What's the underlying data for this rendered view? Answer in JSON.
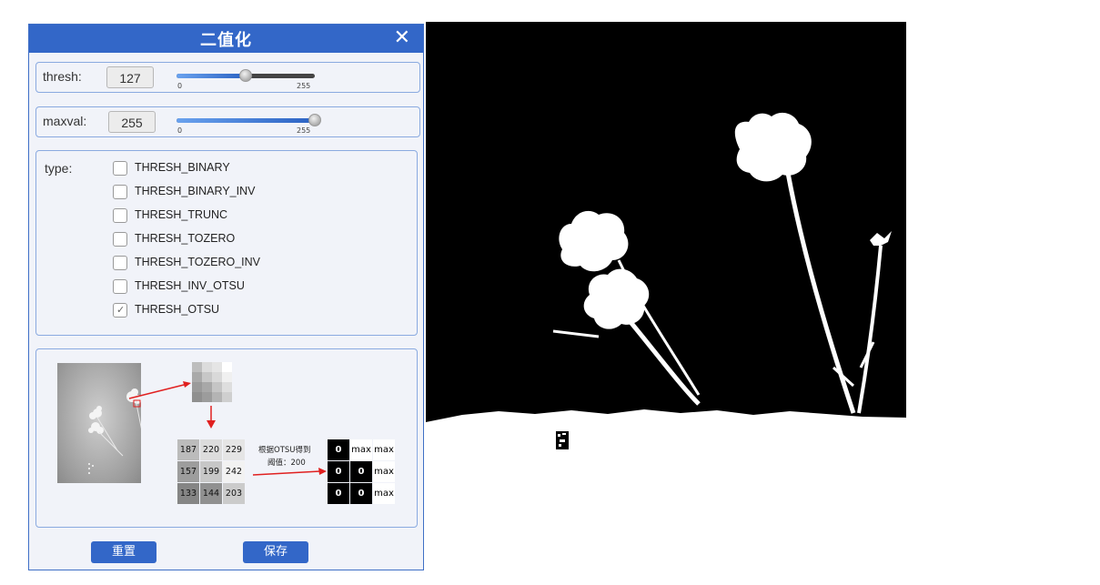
{
  "dialog": {
    "title": "二值化",
    "close_glyph": "✕",
    "thresh": {
      "label": "thresh:",
      "value": "127",
      "min_label": "0",
      "max_label": "255",
      "fraction": 0.498
    },
    "maxval": {
      "label": "maxval:",
      "value": "255",
      "min_label": "0",
      "max_label": "255",
      "fraction": 1.0
    },
    "type": {
      "label": "type:",
      "options": [
        {
          "label": "THRESH_BINARY",
          "checked": false
        },
        {
          "label": "THRESH_BINARY_INV",
          "checked": false
        },
        {
          "label": "THRESH_TRUNC",
          "checked": false
        },
        {
          "label": "THRESH_TOZERO",
          "checked": false
        },
        {
          "label": "THRESH_TOZERO_INV",
          "checked": false
        },
        {
          "label": "THRESH_INV_OTSU",
          "checked": false
        },
        {
          "label": "THRESH_OTSU",
          "checked": true
        }
      ]
    },
    "illustration": {
      "gray_values": [
        [
          "187",
          "220",
          "229"
        ],
        [
          "157",
          "199",
          "242"
        ],
        [
          "133",
          "144",
          "203"
        ]
      ],
      "note_line1": "根据OTSU得到",
      "note_line2": "阈值：200",
      "binary_values": [
        [
          "0",
          "max",
          "max"
        ],
        [
          "0",
          "0",
          "max"
        ],
        [
          "0",
          "0",
          "max"
        ]
      ]
    },
    "buttons": {
      "reset": "重置",
      "save": "保存"
    }
  },
  "colors": {
    "accent": "#3367c8",
    "arrow": "#e02020",
    "panel_bg": "#f1f3f9"
  },
  "icons": {
    "close": "close-icon",
    "checkmark": "checkmark-icon"
  }
}
